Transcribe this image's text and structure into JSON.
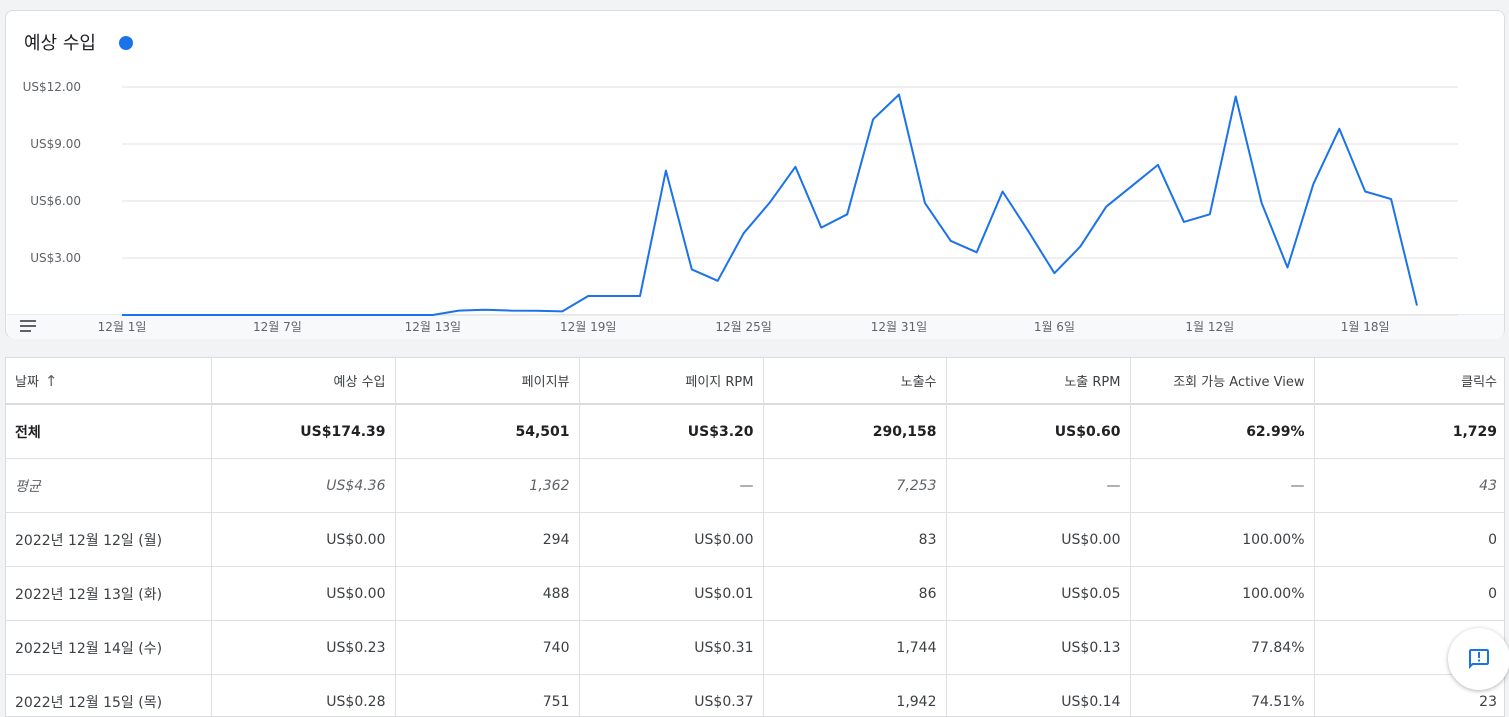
{
  "chart": {
    "title": "예상 수입",
    "accent_color": "#1a73e8",
    "menu_icon": "menu-icon"
  },
  "chart_data": {
    "type": "line",
    "title": "예상 수입",
    "y_ticks": [
      "US$3.00",
      "US$6.00",
      "US$9.00",
      "US$12.00"
    ],
    "ylim": [
      0,
      12.5
    ],
    "x_tick_labels": [
      "12월 1일",
      "12월 7일",
      "12월 13일",
      "12월 19일",
      "12월 25일",
      "12월 31일",
      "1월 6일",
      "1월 12일",
      "1월 18일"
    ],
    "x_tick_indices": [
      0,
      6,
      12,
      18,
      24,
      30,
      36,
      42,
      48
    ],
    "grid": true,
    "series": [
      {
        "name": "예상 수입",
        "color": "#1a73e8",
        "values": [
          0,
          0,
          0,
          0,
          0,
          0,
          0,
          0,
          0,
          0,
          0,
          0,
          0,
          0.23,
          0.28,
          0.23,
          0.22,
          0.19,
          1.0,
          1.0,
          1.0,
          7.6,
          2.4,
          1.8,
          4.3,
          5.9,
          7.8,
          4.6,
          5.3,
          10.3,
          11.6,
          5.9,
          3.9,
          3.3,
          6.5,
          4.4,
          2.2,
          3.6,
          5.7,
          6.8,
          7.9,
          4.9,
          5.3,
          11.5,
          5.9,
          2.5,
          6.9,
          9.8,
          6.5,
          6.1,
          0.5
        ]
      }
    ]
  },
  "table": {
    "sort_icon": "arrow-up-icon",
    "columns": [
      "날짜",
      "예상 수입",
      "페이지뷰",
      "페이지 RPM",
      "노출수",
      "노출 RPM",
      "조회 가능 Active View",
      "클릭수"
    ],
    "total": [
      "전체",
      "US$174.39",
      "54,501",
      "US$3.20",
      "290,158",
      "US$0.60",
      "62.99%",
      "1,729"
    ],
    "average": [
      "평균",
      "US$4.36",
      "1,362",
      "—",
      "7,253",
      "—",
      "—",
      "43"
    ],
    "rows": [
      [
        "2022년 12월 12일 (월)",
        "US$0.00",
        "294",
        "US$0.00",
        "83",
        "US$0.00",
        "100.00%",
        "0"
      ],
      [
        "2022년 12월 13일 (화)",
        "US$0.00",
        "488",
        "US$0.01",
        "86",
        "US$0.05",
        "100.00%",
        "0"
      ],
      [
        "2022년 12월 14일 (수)",
        "US$0.23",
        "740",
        "US$0.31",
        "1,744",
        "US$0.13",
        "77.84%",
        ""
      ],
      [
        "2022년 12월 15일 (목)",
        "US$0.28",
        "751",
        "US$0.37",
        "1,942",
        "US$0.14",
        "74.51%",
        "23"
      ]
    ]
  },
  "feedback": {
    "icon": "feedback-icon"
  }
}
